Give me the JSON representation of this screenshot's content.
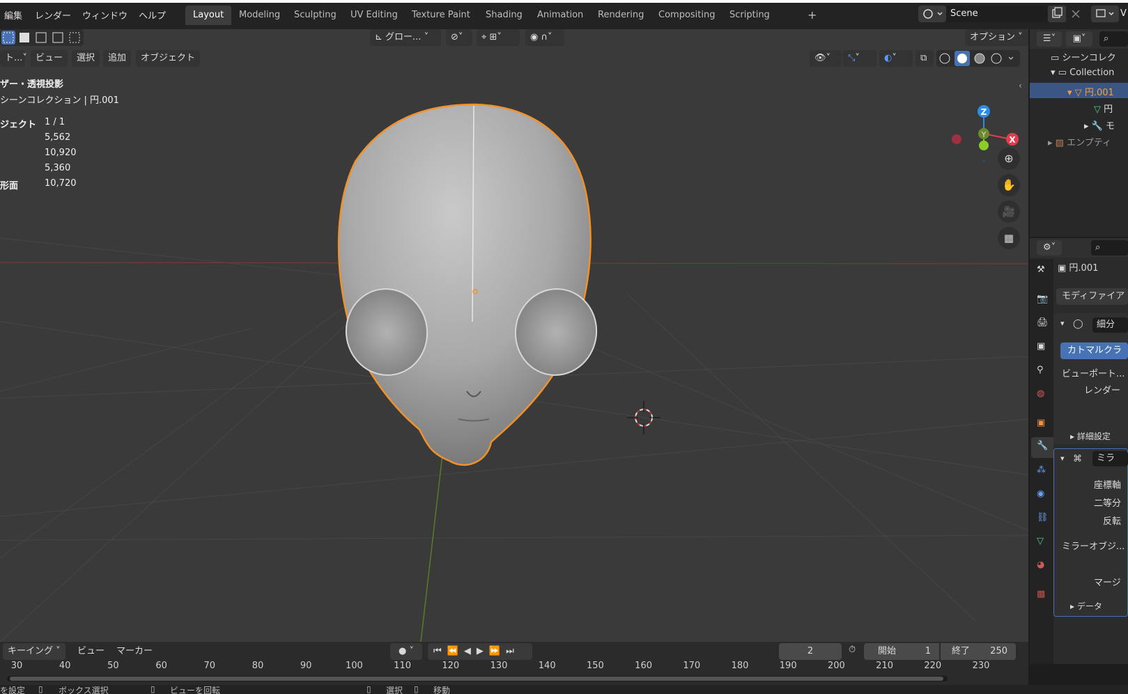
{
  "menu": [
    "編集",
    "レンダー",
    "ウィンドウ",
    "ヘルプ"
  ],
  "workspaces": [
    {
      "label": "Layout",
      "active": true
    },
    {
      "label": "Modeling"
    },
    {
      "label": "Sculpting"
    },
    {
      "label": "UV Editing"
    },
    {
      "label": "Texture Paint"
    },
    {
      "label": "Shading"
    },
    {
      "label": "Animation"
    },
    {
      "label": "Rendering"
    },
    {
      "label": "Compositing"
    },
    {
      "label": "Scripting"
    }
  ],
  "add_workspace": "+",
  "scene": {
    "name": "Scene",
    "label_v": "V"
  },
  "toolbar": {
    "transform_orientation": "グロー...",
    "options_label": "オプション"
  },
  "viewport_header": {
    "mode": "ト...",
    "view": "ビュー",
    "select": "選択",
    "add": "追加",
    "object": "オブジェクト"
  },
  "overlay_info": {
    "view_name": "ザー・透視投影",
    "collection": "シーンコレクション | 円.001",
    "rows": [
      {
        "label": "ジェクト",
        "value": "1 / 1"
      },
      {
        "label": "",
        "value": "5,562"
      },
      {
        "label": "",
        "value": "10,920"
      },
      {
        "label": "",
        "value": "5,360"
      },
      {
        "label": "形面",
        "value": "10,720"
      }
    ]
  },
  "gizmo": {
    "z": "Z",
    "y": "Y",
    "x": "X"
  },
  "outliner": {
    "scene_collection": "シーンコレク",
    "collection": "Collection",
    "object": "円.001",
    "mesh": "円",
    "modifier": "モ",
    "empty": "エンプティ"
  },
  "properties": {
    "object_name": "円.001",
    "add_modifier": "モディファイア",
    "subsurf_name": "細分",
    "catmull": "カトマルクラ",
    "viewport_level": "ビューポート...",
    "render_level": "レンダー",
    "advanced": "詳細設定",
    "mirror_name": "ミラ",
    "axis": "座標軸",
    "bisect": "二等分",
    "flip": "反転",
    "mirror_object": "ミラーオブジ...",
    "merge": "マージ",
    "data": "データ"
  },
  "timeline": {
    "keying": "キーイング",
    "view": "ビュー",
    "marker": "マーカー",
    "current_frame": "2",
    "start_label": "開始",
    "start_value": "1",
    "end_label": "終了",
    "end_value": "250",
    "ticks": [
      "30",
      "40",
      "50",
      "60",
      "70",
      "80",
      "90",
      "100",
      "110",
      "120",
      "130",
      "140",
      "150",
      "160",
      "170",
      "180",
      "190",
      "200",
      "210",
      "220",
      "230"
    ]
  },
  "status": {
    "item1": "を設定",
    "item2": "ボックス選択",
    "item3": "ビューを回転",
    "item4": "選択",
    "item5": "移動"
  }
}
